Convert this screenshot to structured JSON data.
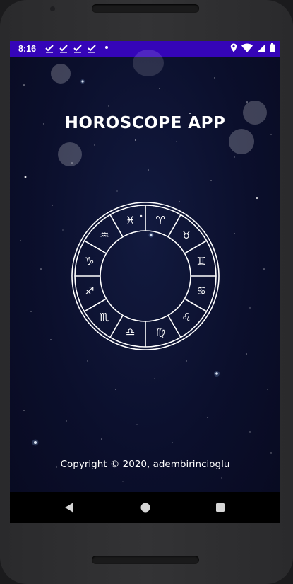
{
  "status_bar": {
    "time": "8:16",
    "notification_icons": [
      "download-done-icon",
      "download-done-icon",
      "download-done-icon",
      "download-done-icon",
      "more-dot-icon"
    ],
    "right_icons": [
      "location-icon",
      "wifi-icon",
      "signal-icon",
      "battery-icon"
    ],
    "color": "#3505b8"
  },
  "app": {
    "title": "HOROSCOPE APP",
    "wheel_icon": "zodiac-wheel-icon",
    "zodiac_glyphs": [
      "♈",
      "♉",
      "♊",
      "♋",
      "♌",
      "♍",
      "♎",
      "♏",
      "♐",
      "♑",
      "♒",
      "♓"
    ],
    "copyright": "Copyright © 2020, adembirincioglu",
    "background": "#0b0f2c"
  },
  "nav_bar": {
    "back": "back-triangle-icon",
    "home": "home-circle-icon",
    "recents": "recents-square-icon"
  }
}
